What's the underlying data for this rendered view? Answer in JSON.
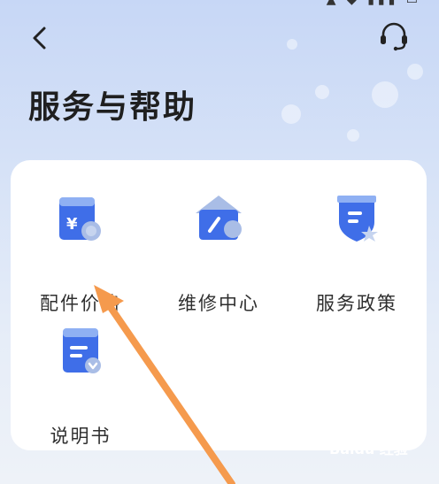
{
  "header": {
    "title": "服务与帮助",
    "back_icon": "chevron-left-icon",
    "support_icon": "headset-icon"
  },
  "services": [
    {
      "label": "配件价格",
      "icon": "price-tag-icon"
    },
    {
      "label": "维修中心",
      "icon": "repair-center-icon"
    },
    {
      "label": "服务政策",
      "icon": "policy-shield-icon"
    },
    {
      "label": "说明书",
      "icon": "manual-icon"
    }
  ],
  "colors": {
    "accent_blue": "#3f6ee8",
    "annotation_arrow": "#f59a4d"
  },
  "watermark": "Baidu 经验"
}
